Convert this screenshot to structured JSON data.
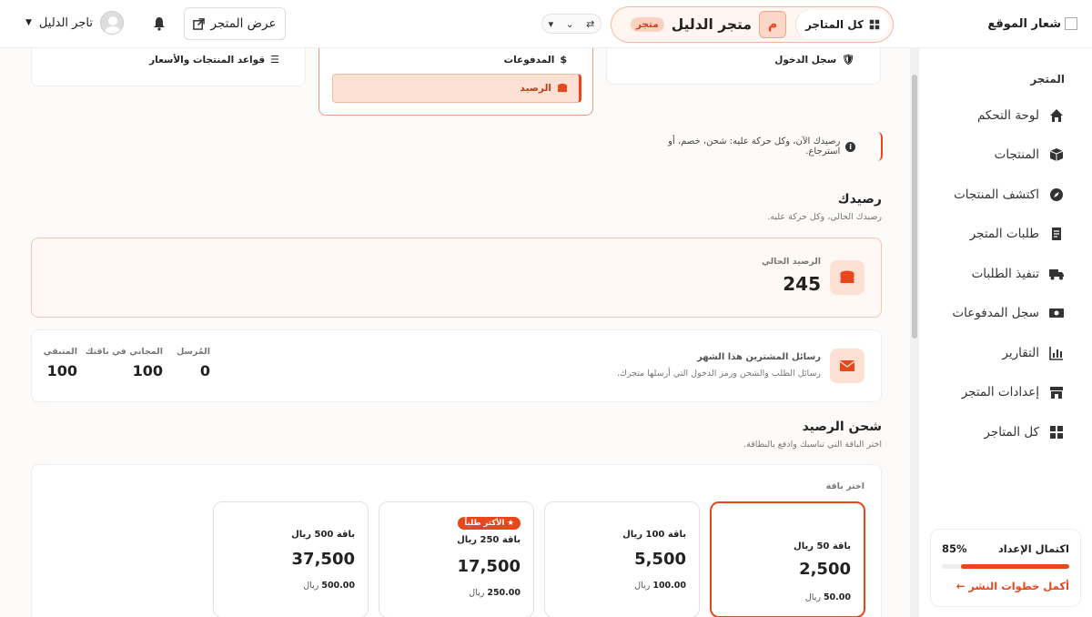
{
  "sidebar": {
    "logo_text": "شعار الموقع",
    "section_label": "المتجر",
    "items": [
      {
        "label": "لوحة التحكم",
        "icon": "home-icon"
      },
      {
        "label": "المنتجات",
        "icon": "boxes-icon"
      },
      {
        "label": "اكتشف المنتجات",
        "icon": "compass-icon"
      },
      {
        "label": "طلبات المتجر",
        "icon": "receipt-icon"
      },
      {
        "label": "تنفيذ الطلبات",
        "icon": "truck-icon"
      },
      {
        "label": "سجل المدفوعات",
        "icon": "money-icon"
      },
      {
        "label": "التقارير",
        "icon": "chart-icon"
      },
      {
        "label": "إعدادات المتجر",
        "icon": "store-icon"
      },
      {
        "label": "كل المتاجر",
        "icon": "grid-icon"
      }
    ],
    "setup": {
      "title": "اكتمال الإعداد",
      "percent": "85%",
      "progress": 0.85,
      "cta": "أكمل خطوات النشر ←"
    }
  },
  "topbar": {
    "all_stores": "كل المتاجر",
    "store_initial": "م",
    "store_name": "متجر الدليل",
    "store_tag": "متجر",
    "view_store": "عرض المتجر",
    "user_name": "تاجر الدليل"
  },
  "tabs": {
    "login_log": "سجل الدخول",
    "payments": "المدفوعات",
    "balance": "الرصيد",
    "product_rules": "قواعد المنتجات والأسعار"
  },
  "info": "رصيدك الآن، وكل حركة عليه: شحن، خصم، أو استرجاع.",
  "balance_section": {
    "title": "رصيدك",
    "subtitle": "رصيدك الحالي، وكل حركة عليه.",
    "current_label": "الرصيد الحالي",
    "current_value": "245"
  },
  "messages": {
    "title": "رسائل المشترين هذا الشهر",
    "desc": "رسائل الطلب والشحن ورمز الدخول التي أرسلها متجرك.",
    "stats": [
      {
        "label": "المُرسل",
        "value": "0"
      },
      {
        "label": "المجاني في باقتك",
        "value": "100"
      },
      {
        "label": "المتبقي",
        "value": "100"
      }
    ]
  },
  "topup": {
    "title": "شحن الرصيد",
    "subtitle": "اختر الباقة التي تناسبك وادفع بالبطاقة.",
    "pick_label": "اختر باقة",
    "currency": "ريال",
    "packages": [
      {
        "name": "باقة 50 ريال",
        "points": "2,500",
        "price": "50.00",
        "selected": true,
        "badge": ""
      },
      {
        "name": "باقة 100 ريال",
        "points": "5,500",
        "price": "100.00",
        "selected": false,
        "badge": ""
      },
      {
        "name": "باقة 250 ريال",
        "points": "17,500",
        "price": "250.00",
        "selected": false,
        "badge": "★ الأكثر طلباً"
      },
      {
        "name": "باقة 500 ريال",
        "points": "37,500",
        "price": "500.00",
        "selected": false,
        "badge": ""
      }
    ]
  },
  "colors": {
    "accent": "#e8471c",
    "accent_soft": "#fde0d4"
  }
}
